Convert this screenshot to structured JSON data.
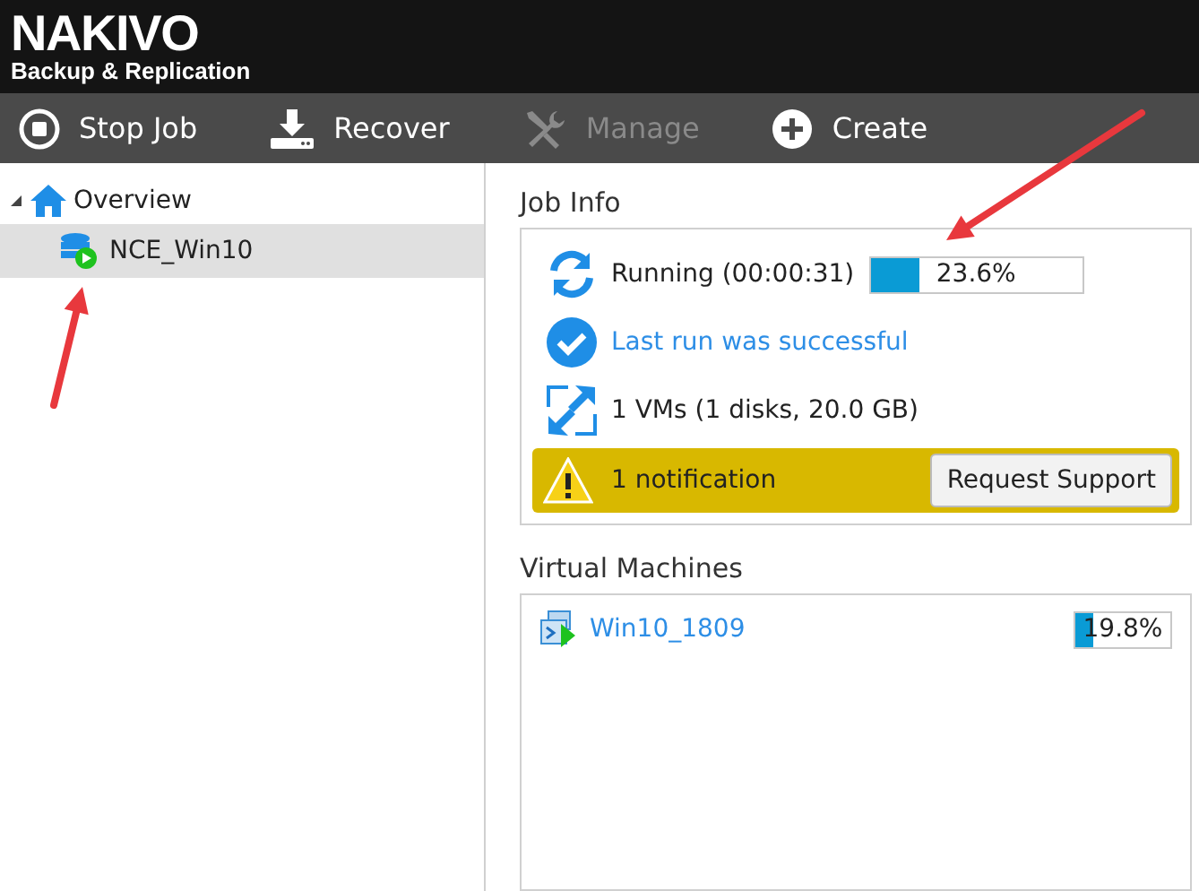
{
  "logo": {
    "name": "NAKIVO",
    "tagline": "Backup & Replication"
  },
  "toolbar": [
    {
      "kind": "stop",
      "label": "Stop Job",
      "disabled": false
    },
    {
      "kind": "recover",
      "label": "Recover",
      "disabled": false
    },
    {
      "kind": "manage",
      "label": "Manage",
      "disabled": true
    },
    {
      "kind": "create",
      "label": "Create",
      "disabled": false
    }
  ],
  "tree": [
    {
      "label": "Overview",
      "expanded": true,
      "selected": false,
      "children": [
        {
          "label": "NCE_Win10",
          "selected": true
        }
      ]
    }
  ],
  "job_info": {
    "title": "Job Info",
    "rows": [
      {
        "kind": "running",
        "label": "Running (00:00:31)",
        "level": 0.236,
        "reading": "23.6%"
      },
      {
        "kind": "success",
        "label": "Last run was successful"
      },
      {
        "kind": "vms",
        "label": "1 VMs (1 disks, 20.0 GB)"
      }
    ],
    "notification": {
      "text": "1 notification",
      "button": "Request Support"
    }
  },
  "virtual_machines": {
    "title": "Virtual Machines",
    "items": [
      {
        "name": "Win10_1809",
        "level": 0.198,
        "reading": "19.8%"
      }
    ]
  }
}
